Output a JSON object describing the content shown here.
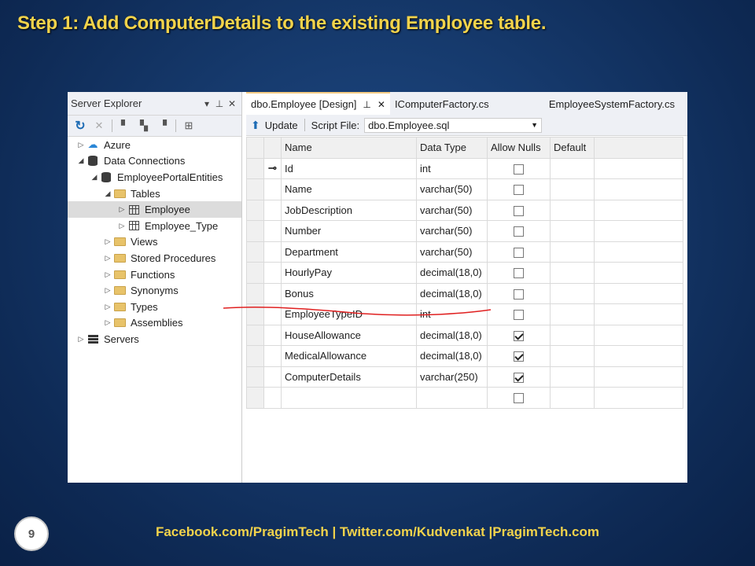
{
  "slide": {
    "title": "Step 1: Add ComputerDetails to the existing Employee table.",
    "page_number": "9",
    "footer": "Facebook.com/PragimTech  | Twitter.com/Kudvenkat  |PragimTech.com"
  },
  "server_explorer": {
    "title": "Server Explorer",
    "tree": [
      {
        "label": "Azure",
        "icon": "azure-icon",
        "state": "collapsed"
      },
      {
        "label": "Data Connections",
        "icon": "database-icon",
        "state": "expanded"
      },
      {
        "label": "EmployeePortalEntities",
        "icon": "database-connection-icon",
        "state": "expanded"
      },
      {
        "label": "Tables",
        "icon": "folder-icon",
        "state": "expanded"
      },
      {
        "label": "Employee",
        "icon": "table-icon",
        "state": "collapsed",
        "selected": true
      },
      {
        "label": "Employee_Type",
        "icon": "table-icon",
        "state": "collapsed"
      },
      {
        "label": "Views",
        "icon": "folder-icon",
        "state": "collapsed"
      },
      {
        "label": "Stored Procedures",
        "icon": "folder-icon",
        "state": "collapsed"
      },
      {
        "label": "Functions",
        "icon": "folder-icon",
        "state": "collapsed"
      },
      {
        "label": "Synonyms",
        "icon": "folder-icon",
        "state": "collapsed"
      },
      {
        "label": "Types",
        "icon": "folder-icon",
        "state": "collapsed"
      },
      {
        "label": "Assemblies",
        "icon": "folder-icon",
        "state": "collapsed"
      },
      {
        "label": "Servers",
        "icon": "servers-icon",
        "state": "collapsed"
      }
    ]
  },
  "editor": {
    "tabs": [
      {
        "label": "dbo.Employee [Design]",
        "active": true
      },
      {
        "label": "IComputerFactory.cs",
        "active": false
      },
      {
        "label": "EmployeeSystemFactory.cs",
        "active": false
      }
    ],
    "toolbar": {
      "update_label": "Update",
      "script_file_label": "Script File:",
      "script_file_value": "dbo.Employee.sql"
    },
    "columns": [
      "Name",
      "Data Type",
      "Allow Nulls",
      "Default"
    ],
    "rows": [
      {
        "name": "Id",
        "type": "int",
        "allow_nulls": false,
        "key": true
      },
      {
        "name": "Name",
        "type": "varchar(50)",
        "allow_nulls": false
      },
      {
        "name": "JobDescription",
        "type": "varchar(50)",
        "allow_nulls": false
      },
      {
        "name": "Number",
        "type": "varchar(50)",
        "allow_nulls": false
      },
      {
        "name": "Department",
        "type": "varchar(50)",
        "allow_nulls": false
      },
      {
        "name": "HourlyPay",
        "type": "decimal(18,0)",
        "allow_nulls": false
      },
      {
        "name": "Bonus",
        "type": "decimal(18,0)",
        "allow_nulls": false
      },
      {
        "name": "EmployeeTypeID",
        "type": "int",
        "allow_nulls": false
      },
      {
        "name": "HouseAllowance",
        "type": "decimal(18,0)",
        "allow_nulls": true
      },
      {
        "name": "MedicalAllowance",
        "type": "decimal(18,0)",
        "allow_nulls": true
      },
      {
        "name": "ComputerDetails",
        "type": "varchar(250)",
        "allow_nulls": true
      },
      {
        "name": "",
        "type": "",
        "allow_nulls": false
      }
    ]
  },
  "colors": {
    "title": "#f2d34b",
    "underline": "#e02020"
  }
}
